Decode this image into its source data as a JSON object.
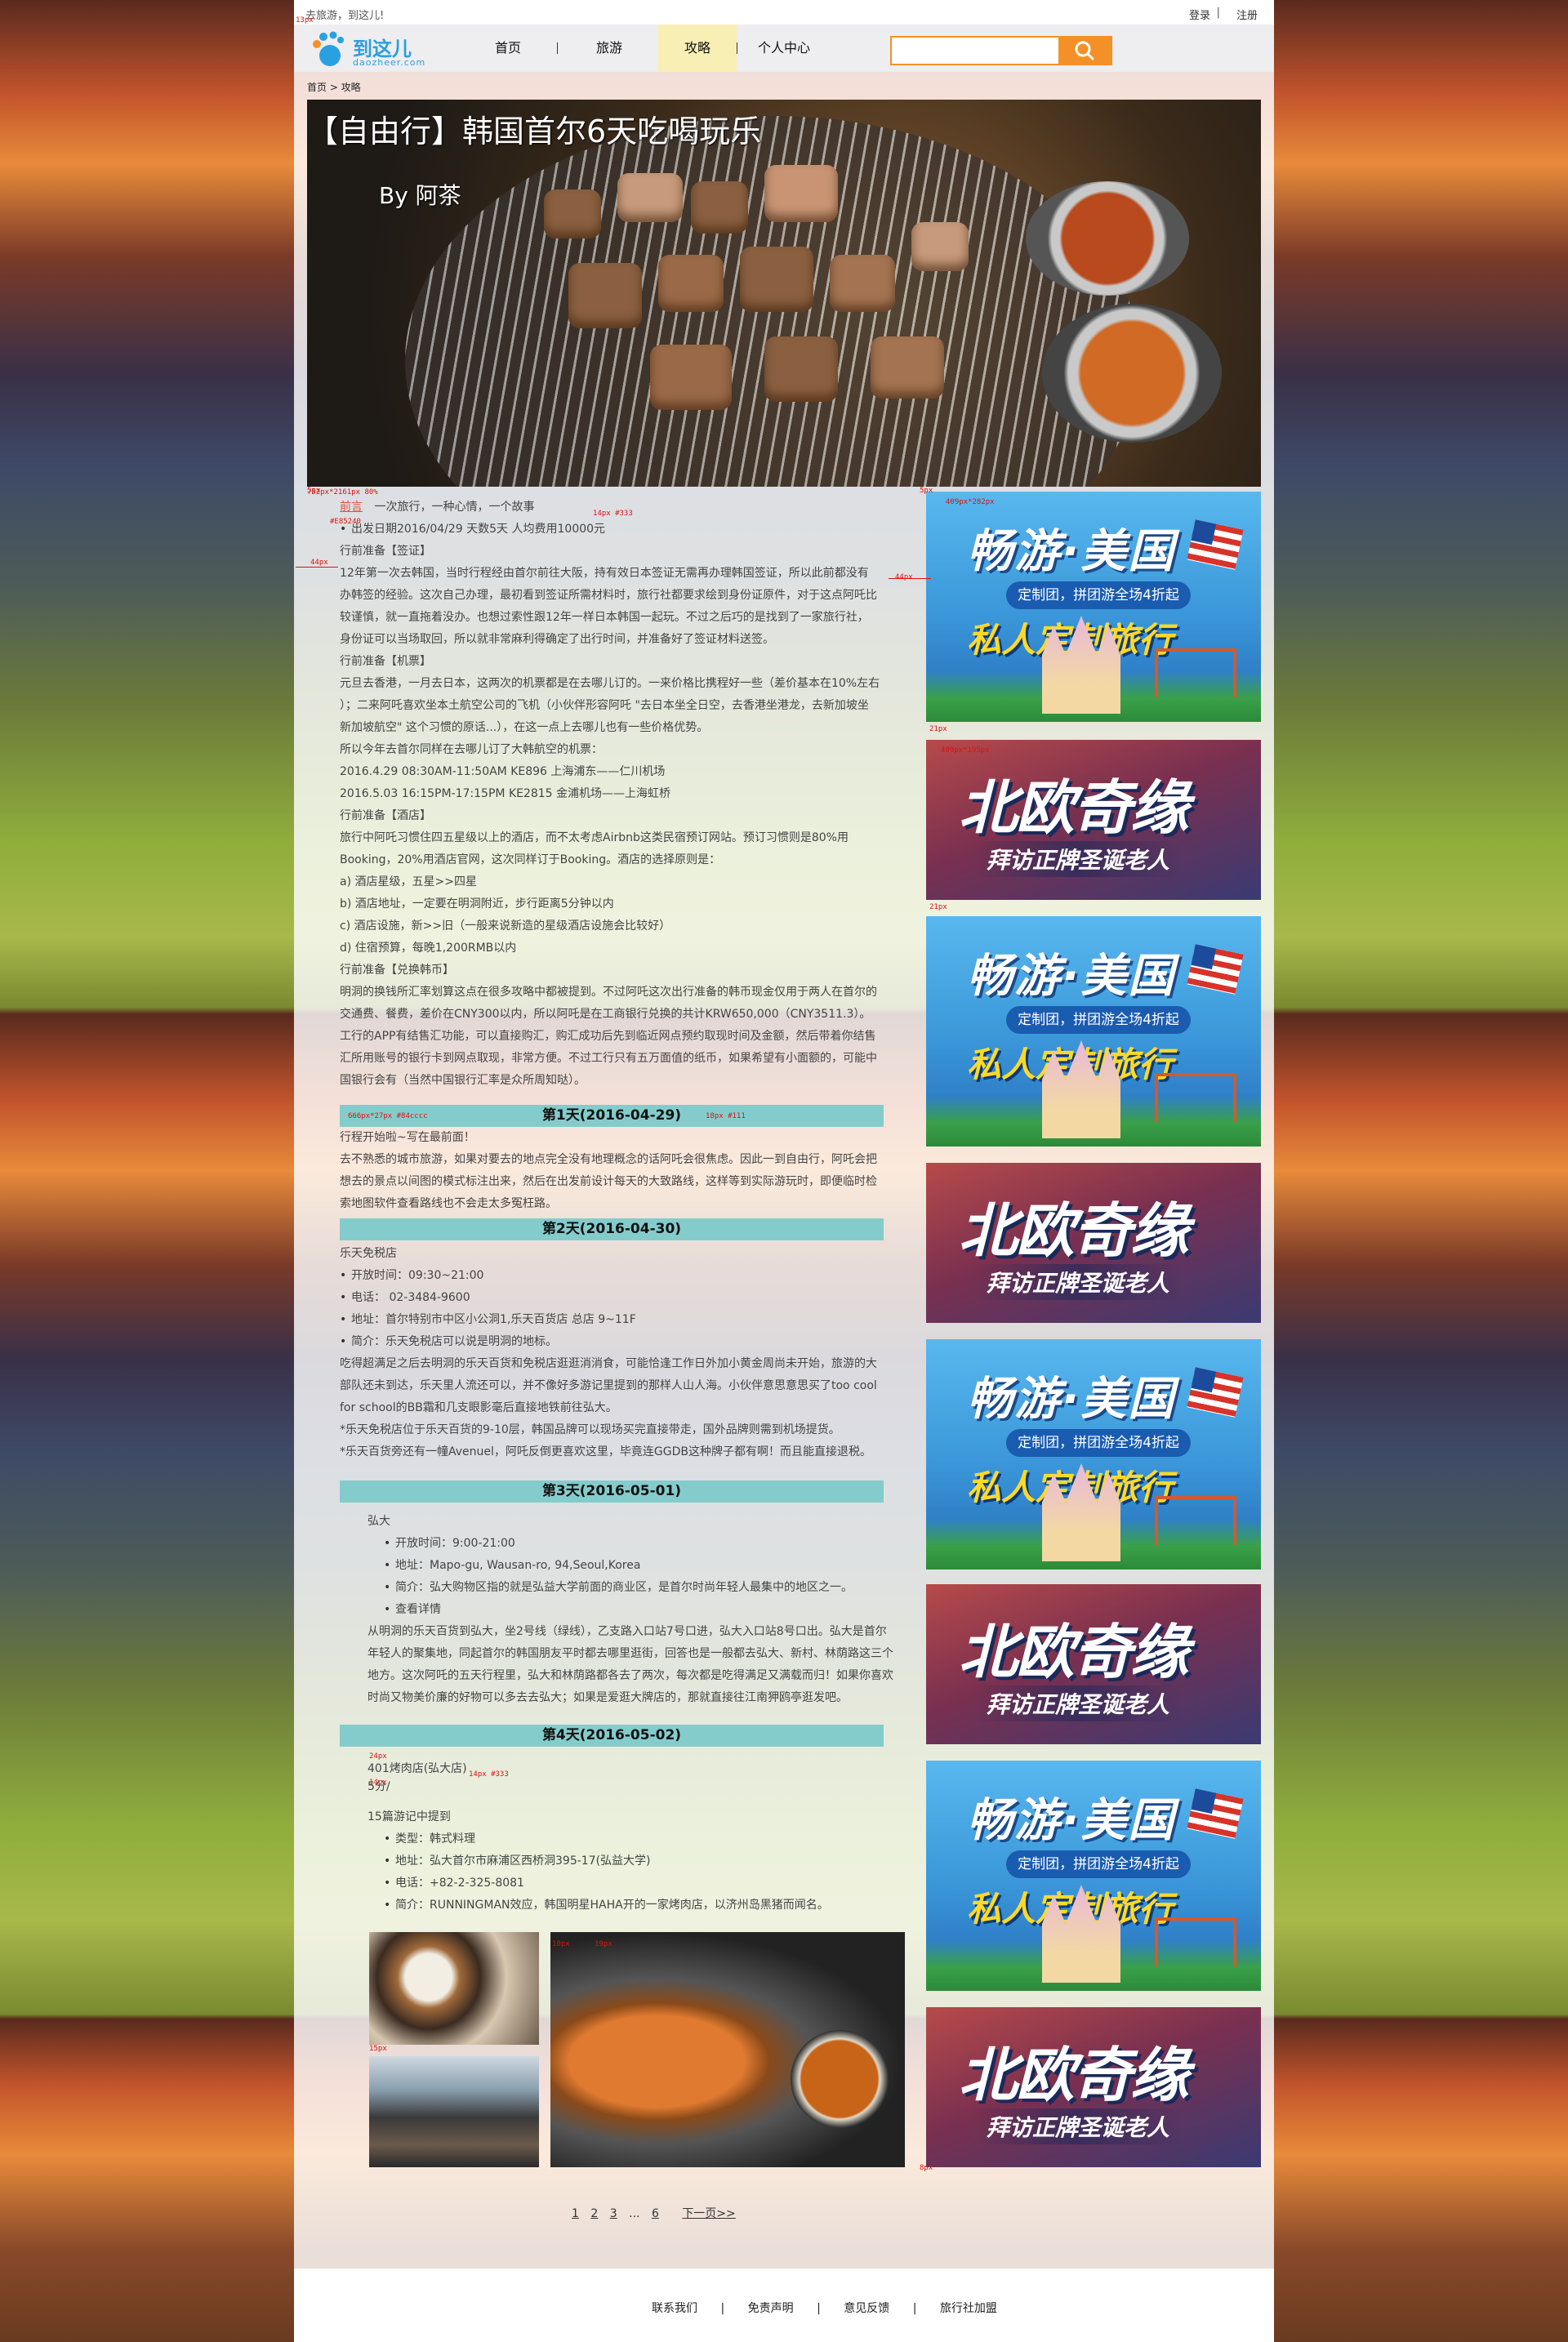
{
  "topbar": {
    "greeting": "去旅游，到这儿!",
    "login": "登录",
    "sep": "|",
    "register": "注册"
  },
  "logo": {
    "name": "到这儿",
    "domain": "daozheer.com"
  },
  "nav": {
    "items": [
      "首页",
      "旅游",
      "攻略",
      "个人中心"
    ],
    "active": "攻略",
    "search_placeholder": ""
  },
  "breadcrumb": "首页 > 攻略",
  "hero": {
    "title": "【自由行】韩国首尔6天吃喝玩乐",
    "byline": "By  阿茶"
  },
  "article": {
    "intro_tag": "前言",
    "intro": "一次旅行，一种心情，一个故事",
    "lines": [
      "出发日期2016/04/29   天数5天  人均费用10000元",
      "行前准备【签证】",
      "12年第一次去韩国，当时行程经由首尔前往大阪，持有效日本签证无需再办理韩国签证，所以此前都没有",
      "办韩签的经验。这次自己办理，最初看到签证所需材料时，旅行社都要求绘到身份证原件，对于这点阿吒比",
      "较谨慎，就一直拖着没办。也想过索性跟12年一样日本韩国一起玩。不过之后巧的是找到了一家旅行社，",
      "身份证可以当场取回，所以就非常麻利得确定了出行时间，并准备好了签证材料送签。",
      "行前准备【机票】",
      "元旦去香港，一月去日本，这两次的机票都是在去哪儿订的。一来价格比携程好一些（差价基本在10%左右",
      "）；二来阿吒喜欢坐本土航空公司的飞机（小伙伴形容阿吒 \"去日本坐全日空，去香港坐港龙，去新加坡坐",
      "新加坡航空\" 这个习惯的原话...），在这一点上去哪儿也有一些价格优势。",
      "所以今年去首尔同样在去哪儿订了大韩航空的机票：",
      "2016.4.29 08:30AM-11:50AM KE896 上海浦东——仁川机场",
      "2016.5.03 16:15PM-17:15PM KE2815 金浦机场——上海虹桥",
      "行前准备【酒店】",
      "旅行中阿吒习惯住四五星级以上的酒店，而不太考虑Airbnb这类民宿预订网站。预订习惯则是80%用",
      "Booking，20%用酒店官网，这次同样订于Booking。酒店的选择原则是：",
      "a) 酒店星级，五星>>四星",
      "b) 酒店地址，一定要在明洞附近，步行距离5分钟以内",
      "c) 酒店设施，新>>旧（一般来说新造的星级酒店设施会比较好）",
      "d) 住宿预算，每晚1,200RMB以内",
      "行前准备【兑换韩币】",
      "明洞的换钱所汇率划算这点在很多攻略中都被提到。不过阿吒这次出行准备的韩币现金仅用于两人在首尔的",
      "交通费、餐费，差价在CNY300以内，所以阿吒是在工商银行兑换的共计KRW650,000（CNY3511.3）。",
      "工行的APP有结售汇功能，可以直接购汇，购汇成功后先到临近网点预约取现时间及金额，然后带着你结售",
      "汇所用账号的银行卡到网点取现，非常方便。不过工行只有五万面值的纸币，如果希望有小面额的，可能中",
      "国银行会有（当然中国银行汇率是众所周知哒）。"
    ],
    "day1": {
      "head": "第1天(2016-04-29)",
      "lines": [
        "行程开始啦~写在最前面！",
        "去不熟悉的城市旅游，如果对要去的地点完全没有地理概念的话阿吒会很焦虑。因此一到自由行，阿吒会把",
        "想去的景点以间图的模式标注出来，然后在出发前设计每天的大致路线，这样等到实际游玩时，即便临时检",
        "索地图软件查看路线也不会走太多冤枉路。"
      ]
    },
    "day2": {
      "head": "第2天(2016-04-30)",
      "place": "乐天免税店",
      "bullets": [
        "开放时间：09:30~21:00",
        "电话： 02-3484-9600",
        "地址：首尔特别市中区小公洞1,乐天百货店 总店 9~11F",
        "简介：乐天免税店可以说是明洞的地标。"
      ],
      "lines": [
        "吃得超满足之后去明洞的乐天百货和免税店逛逛消消食，可能恰逢工作日外加小黄金周尚未开始，旅游的大",
        "部队还未到达，乐天里人流还可以，并不像好多游记里提到的那样人山人海。小伙伴意思意思买了too cool",
        "for school的BB霜和几支眼影毫后直接地铁前往弘大。",
        "*乐天免税店位于乐天百货的9-10层，韩国品牌可以现场买完直接带走，国外品牌则需到机场提货。",
        "*乐天百货旁还有一幢Avenuel，阿吒反倒更喜欢这里，毕竟连GGDB这种牌子都有啊！而且能直接退税。"
      ]
    },
    "day3": {
      "head": "第3天(2016-05-01)",
      "place": "弘大",
      "bullets": [
        "开放时间：9:00-21:00",
        "地址：Mapo-gu, Wausan-ro, 94,Seoul,Korea",
        "简介：弘大购物区指的就是弘益大学前面的商业区，是首尔时尚年轻人最集中的地区之一。",
        "查看详情"
      ],
      "lines": [
        "从明洞的乐天百货到弘大，坐2号线（绿线），乙支路入口站7号口进，弘大入口站8号口出。弘大是首尔",
        "年轻人的聚集地，同起首尔的韩国朋友平时都去哪里逛街，回答也是一般都去弘大、新村、林荫路这三个",
        "地方。这次阿吒的五天行程里，弘大和林荫路都各去了两次，每次都是吃得满足又满载而归！如果你喜欢",
        "时尚又物美价廉的好物可以多去去弘大；如果是爱逛大牌店的，那就直接往江南狎鸥亭逛发吧。"
      ]
    },
    "day4": {
      "head": "第4天(2016-05-02)",
      "place": "401烤肉店(弘大店)",
      "rating": "5分/",
      "review": "15篇游记中提到",
      "bullets": [
        "类型：韩式料理",
        "地址：弘大首尔市麻浦区西桥洞395-17(弘益大学)",
        "电话：+82-2-325-8081",
        "简介：RUNNINGMAN效应，韩国明星HAHA开的一家烤肉店，以济州岛黑猪而闻名。"
      ]
    }
  },
  "pager": {
    "pages": [
      "1",
      "2",
      "3",
      "...",
      "6"
    ],
    "next": "下一页>>"
  },
  "ads": [
    {
      "type": "usa",
      "title": "畅游·美国",
      "tag": "定制团，拼团游全场4折起",
      "sub": "私人定制旅行"
    },
    {
      "type": "nordic",
      "title": "北欧奇缘",
      "sub": "拜访正牌圣诞老人"
    },
    {
      "type": "usa",
      "title": "畅游·美国",
      "tag": "定制团，拼团游全场4折起",
      "sub": "私人定制旅行"
    },
    {
      "type": "nordic",
      "title": "北欧奇缘",
      "sub": "拜访正牌圣诞老人"
    },
    {
      "type": "usa",
      "title": "畅游·美国",
      "tag": "定制团，拼团游全场4折起",
      "sub": "私人定制旅行"
    },
    {
      "type": "nordic",
      "title": "北欧奇缘",
      "sub": "拜访正牌圣诞老人"
    },
    {
      "type": "usa",
      "title": "畅游·美国",
      "tag": "定制团，拼团游全场4折起",
      "sub": "私人定制旅行"
    },
    {
      "type": "nordic",
      "title": "北欧奇缘",
      "sub": "拜访正牌圣诞老人"
    }
  ],
  "footer": {
    "links": [
      "联系我们",
      "免责声明",
      "意见反馈",
      "旅行社加盟"
    ],
    "sep": "|"
  },
  "annotations": {
    "a1": "752px*2161px 80%",
    "a2": "14px #333",
    "a3": "#E85240",
    "a4": "44px",
    "a5": "44px",
    "a6": "666px*27px #84cccc",
    "a7": "18px #111",
    "a8": "409px*282px",
    "a9": "21px",
    "a10": "409px*195px",
    "a11": "21px",
    "a12": "24px",
    "a13": "14px",
    "a14": "14px #333",
    "a15": "15px",
    "a16": "10px",
    "a17": "13px",
    "a18": "19px",
    "a19": "5px",
    "a20": "5px",
    "a21": "8px"
  },
  "colors": {
    "accent": "#f39128",
    "dayhead": "#84cccc",
    "nav_active": "#f8efb4",
    "link": "#2aa0e0"
  }
}
